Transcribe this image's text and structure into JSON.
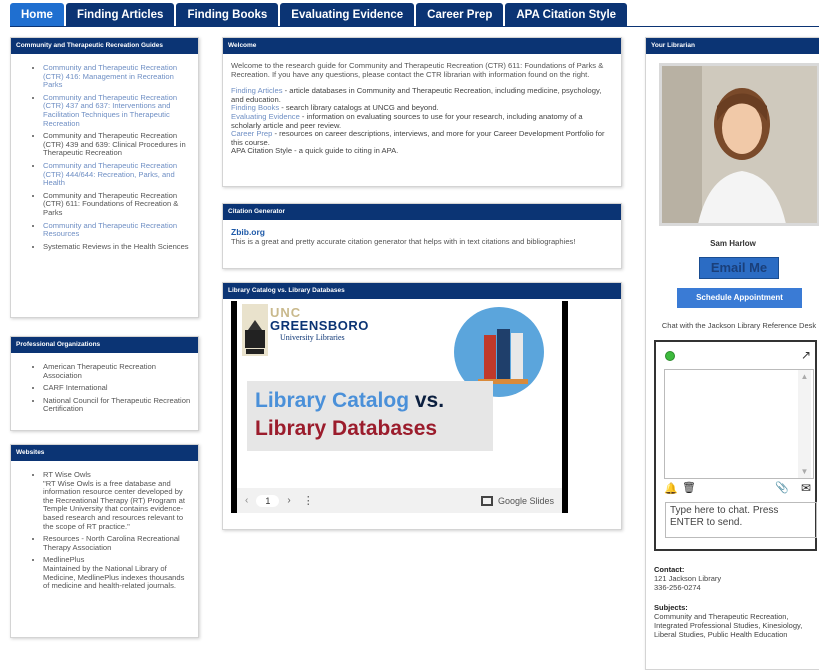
{
  "tabs": [
    "Home",
    "Finding Articles",
    "Finding Books",
    "Evaluating Evidence",
    "Career Prep",
    "APA Citation Style"
  ],
  "guides": {
    "heading": "Community and Therapeutic Recreation Guides",
    "items": [
      {
        "text": "Community and Therapeutic Recreation (CTR) 416: Management in Recreation Parks",
        "link": true
      },
      {
        "text": "Community and Therapeutic Recreation (CTR) 437 and 637: Interventions and Facilitation Techniques in Therapeutic Recreation",
        "link": true
      },
      {
        "text": "Community and Therapeutic Recreation (CTR) 439 and 639: Clinical Procedures in Therapeutic Recreation",
        "link": false
      },
      {
        "text": "Community and Therapeutic Recreation (CTR) 444/644: Recreation, Parks, and Health",
        "link": true
      },
      {
        "text": "Community and Therapeutic Recreation (CTR) 611: Foundations of Recreation & Parks",
        "link": false
      },
      {
        "text": "Community and Therapeutic Recreation Resources",
        "link": true
      },
      {
        "text": "Systematic Reviews in the Health Sciences",
        "link": false
      }
    ]
  },
  "orgs": {
    "heading": "Professional Organizations",
    "items": [
      "American Therapeutic Recreation Association",
      "CARF International",
      "National Council for Therapeutic Recreation Certification"
    ]
  },
  "websites": {
    "heading": "Websites",
    "items": [
      {
        "title": "RT Wise Owls",
        "desc": "\"RT Wise Owls is a free database and information resource center developed by the Recreational Therapy (RT) Program at Temple University that contains evidence-based research and resources relevant to the scope of RT practice.\""
      },
      {
        "title": "Resources - North Carolina Recreational Therapy Association",
        "desc": ""
      },
      {
        "title": "MedlinePlus",
        "desc": "Maintained by the National Library of Medicine, MedlinePlus indexes thousands of medicine and health-related journals."
      }
    ]
  },
  "welcome": {
    "heading": "Welcome",
    "intro": "Welcome to the research guide for Community and Therapeutic Recreation (CTR) 611: Foundations of Parks & Recreation.  If you have any questions, please contact the CTR librarian with information found on the right.",
    "lines": [
      {
        "link": "Finding Articles",
        "text": " - article databases in Community and Therapeutic Recreation, including medicine, psychology, and education."
      },
      {
        "link": "Finding Books",
        "text": " - search library catalogs at UNCG and beyond."
      },
      {
        "link": "Evaluating Evidence",
        "text": " - information on evaluating sources to use for your research, including anatomy of a scholarly article and peer review."
      },
      {
        "link": "Career Prep",
        "text": " - resources on career descriptions, interviews, and more for your Career Development Portfolio for this course."
      },
      {
        "link": "",
        "text": "APA Citation Style - a quick guide to citing in APA."
      }
    ]
  },
  "citation": {
    "heading": "Citation Generator",
    "link": "Zbib.org",
    "text": "This is a great and pretty accurate citation generator that helps with in text citations and bibliographies!"
  },
  "catalog": {
    "heading": "Library Catalog vs. Library Databases",
    "slide_unc": "UNC",
    "slide_greensboro": "GREENSBORO",
    "slide_ul": "University Libraries",
    "slide_line1a": "Library Catalog",
    "slide_line1b": " vs.",
    "slide_line2": "Library Databases",
    "page": "1",
    "google_slides": "Google Slides"
  },
  "librarian": {
    "heading": "Your Librarian",
    "name": "Sam Harlow",
    "email_label": "Email Me",
    "schedule_label": "Schedule Appointment",
    "chat_label": "Chat with the Jackson Library Reference Desk",
    "chat_placeholder": "Type here to chat. Press ENTER to send.",
    "contact_label": "Contact:",
    "contact_lines": [
      "121 Jackson Library",
      "336-256-0274"
    ],
    "subjects_label": "Subjects:",
    "subjects_text": "Community and Therapeutic Recreation, Integrated Professional Studies, Kinesiology, Liberal Studies, Public Health Education"
  },
  "colors": {
    "nav": "#0b3474",
    "active_tab": "#1f6fd0",
    "link": "#6f8fc4",
    "button": "#2b6cc4"
  }
}
